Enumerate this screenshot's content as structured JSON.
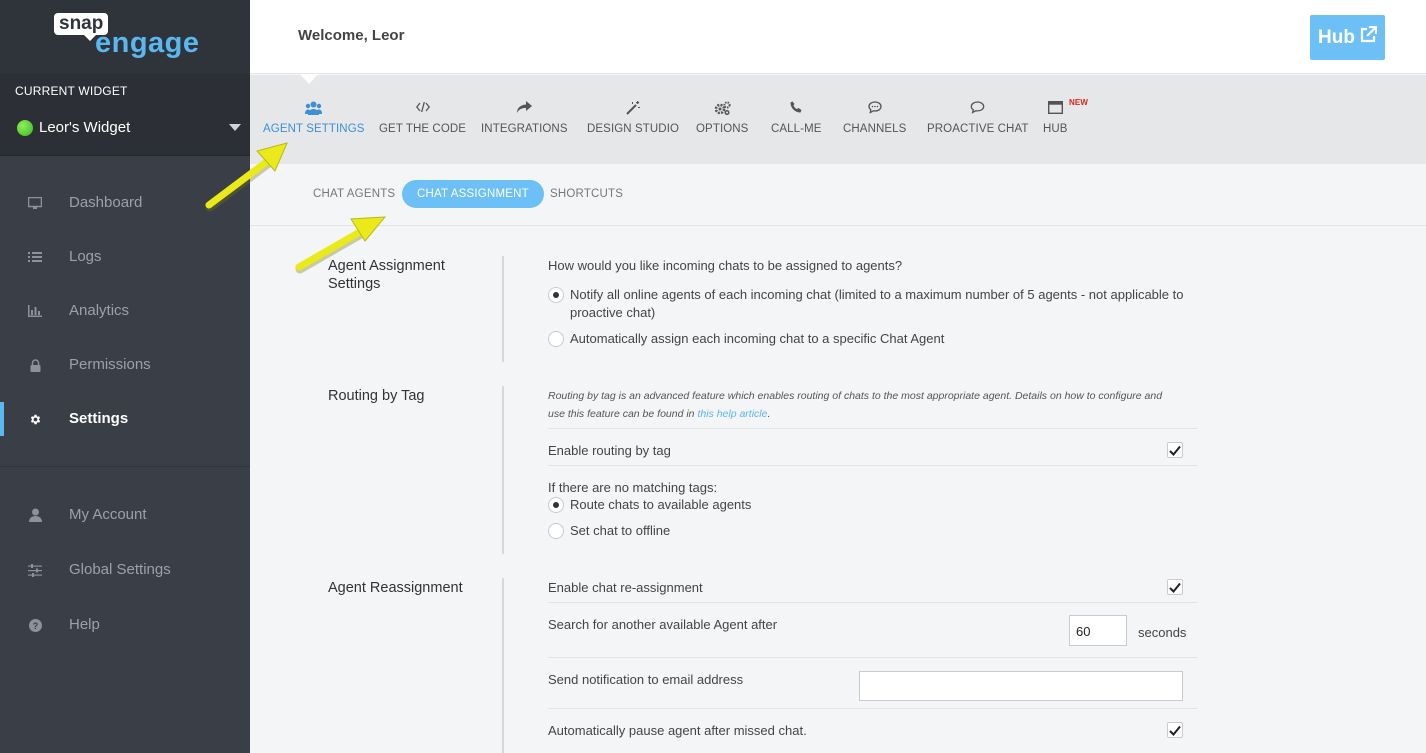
{
  "brand": {
    "word1": "snap",
    "word2": "engage"
  },
  "sidebar": {
    "current_widget_label": "CURRENT WIDGET",
    "widget_name": "Leor's Widget",
    "items": [
      {
        "label": "Dashboard",
        "icon": "monitor-icon"
      },
      {
        "label": "Logs",
        "icon": "list-icon"
      },
      {
        "label": "Analytics",
        "icon": "bar-chart-icon"
      },
      {
        "label": "Permissions",
        "icon": "lock-icon"
      },
      {
        "label": "Settings",
        "icon": "gear-icon",
        "active": true
      }
    ],
    "items2": [
      {
        "label": "My Account",
        "icon": "user-icon"
      },
      {
        "label": "Global Settings",
        "icon": "sliders-icon"
      },
      {
        "label": "Help",
        "icon": "help-icon"
      }
    ]
  },
  "header": {
    "welcome": "Welcome, Leor",
    "hub_label": "Hub"
  },
  "top_tabs": [
    {
      "label": "AGENT SETTINGS",
      "icon": "users-icon",
      "active": true
    },
    {
      "label": "GET THE CODE",
      "icon": "code-icon"
    },
    {
      "label": "INTEGRATIONS",
      "icon": "share-icon"
    },
    {
      "label": "DESIGN STUDIO",
      "icon": "magic-wand-icon"
    },
    {
      "label": "OPTIONS",
      "icon": "gears-icon"
    },
    {
      "label": "CALL-ME",
      "icon": "phone-icon"
    },
    {
      "label": "CHANNELS",
      "icon": "chat-bubble-icon"
    },
    {
      "label": "PROACTIVE CHAT",
      "icon": "speech-icon"
    },
    {
      "label": "HUB",
      "icon": "window-icon",
      "badge": "NEW"
    }
  ],
  "sub_tabs": [
    {
      "label": "CHAT AGENTS"
    },
    {
      "label": "CHAT ASSIGNMENT",
      "active": true
    },
    {
      "label": "SHORTCUTS"
    }
  ],
  "assignment": {
    "title_line1": "Agent Assignment",
    "title_line2": "Settings",
    "question": "How would you like incoming chats to be assigned to agents?",
    "option1_line1": "Notify all online agents of each incoming chat (limited to a maximum number of 5 agents - not applicable to",
    "option1_line2": "proactive chat)",
    "option2": "Automatically assign each incoming chat to a specific Chat Agent",
    "selected": 1
  },
  "routing": {
    "title": "Routing by Tag",
    "help_line1": "Routing by tag is an advanced feature which enables routing of chats to the most appropriate agent. Details on how to configure and",
    "help_line2_prefix": "use this feature can be found in ",
    "help_link": "this help article",
    "help_suffix": ".",
    "enable_label": "Enable routing by tag",
    "enable_checked": true,
    "no_match_label": "If there are no matching tags:",
    "option1": "Route chats to available agents",
    "option2": "Set chat to offline",
    "selected": 1
  },
  "reassignment": {
    "title": "Agent Reassignment",
    "enable_label": "Enable chat re-assignment",
    "enable_checked": true,
    "search_label": "Search for another available Agent after",
    "search_value": "60",
    "seconds_label": "seconds",
    "email_label": "Send notification to email address",
    "email_value": "",
    "pause_label": "Automatically pause agent after missed chat.",
    "pause_checked": true
  },
  "colors": {
    "accent": "#5ab7f0",
    "sidebar": "#3a3f47",
    "arrow": "#f2f21e"
  }
}
